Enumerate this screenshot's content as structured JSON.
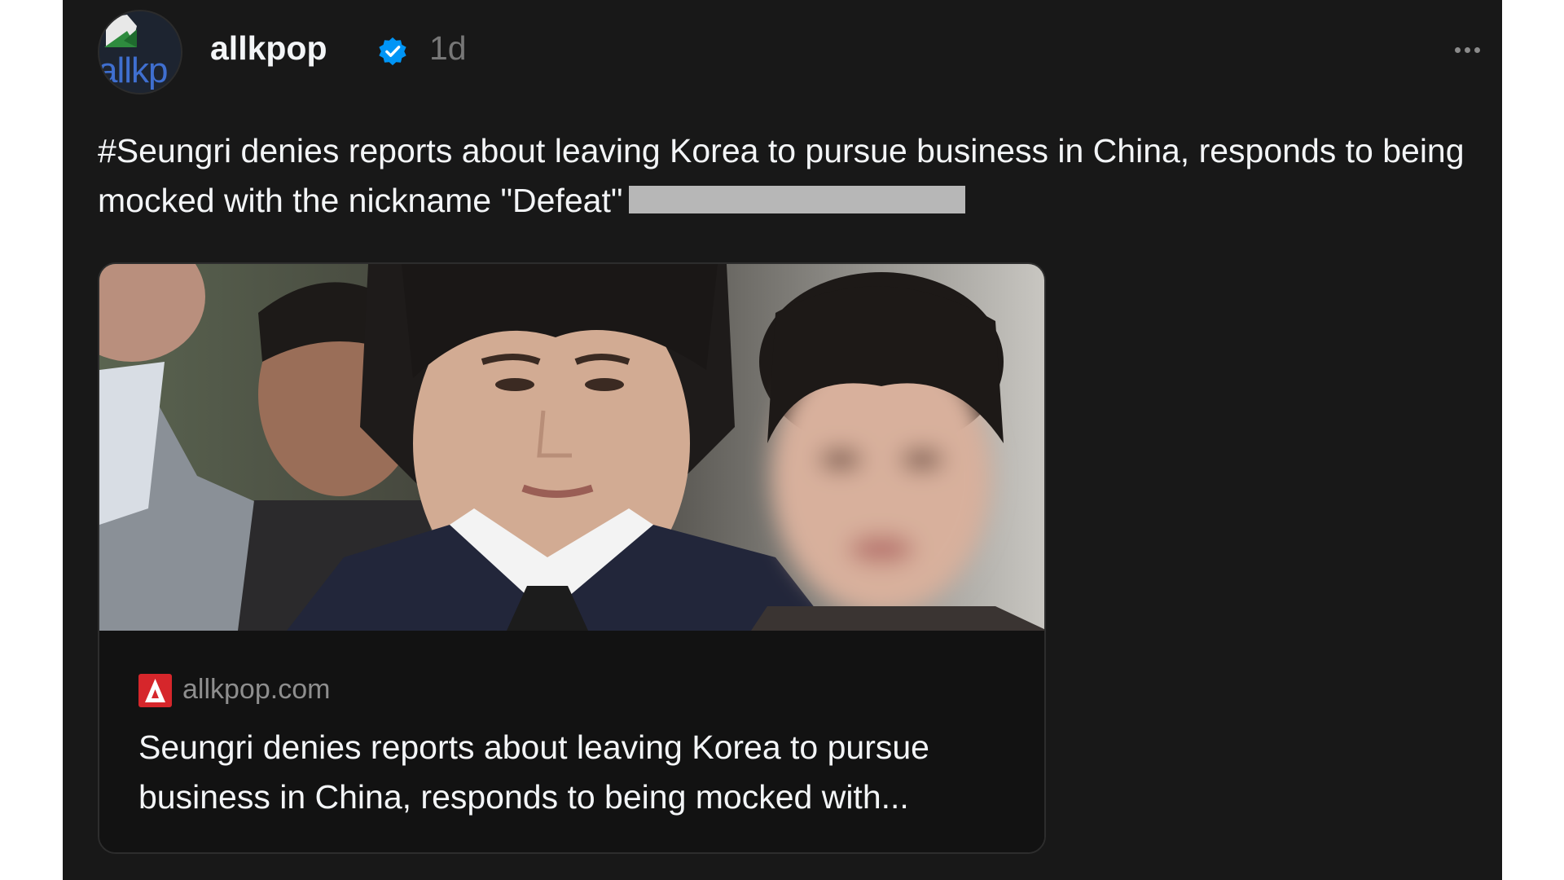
{
  "post": {
    "author": {
      "username": "allkpop",
      "avatar_text": "allkp",
      "verified": true
    },
    "timestamp": "1d",
    "menu_icon": "more-horizontal-icon",
    "caption": "#Seungri denies reports about leaving Korea to pursue business in China, responds to being mocked with the nickname \"Defeat\"",
    "link_preview": {
      "domain": "allkpop.com",
      "title": "Seungri denies reports about leaving Korea to pursue business in China, responds to being mocked with..."
    }
  },
  "colors": {
    "background": "#181818",
    "text": "#f3f5f7",
    "muted": "#777777",
    "verified": "#0095f6",
    "redaction": "#b7b7b7",
    "site_icon": "#d6262b"
  }
}
